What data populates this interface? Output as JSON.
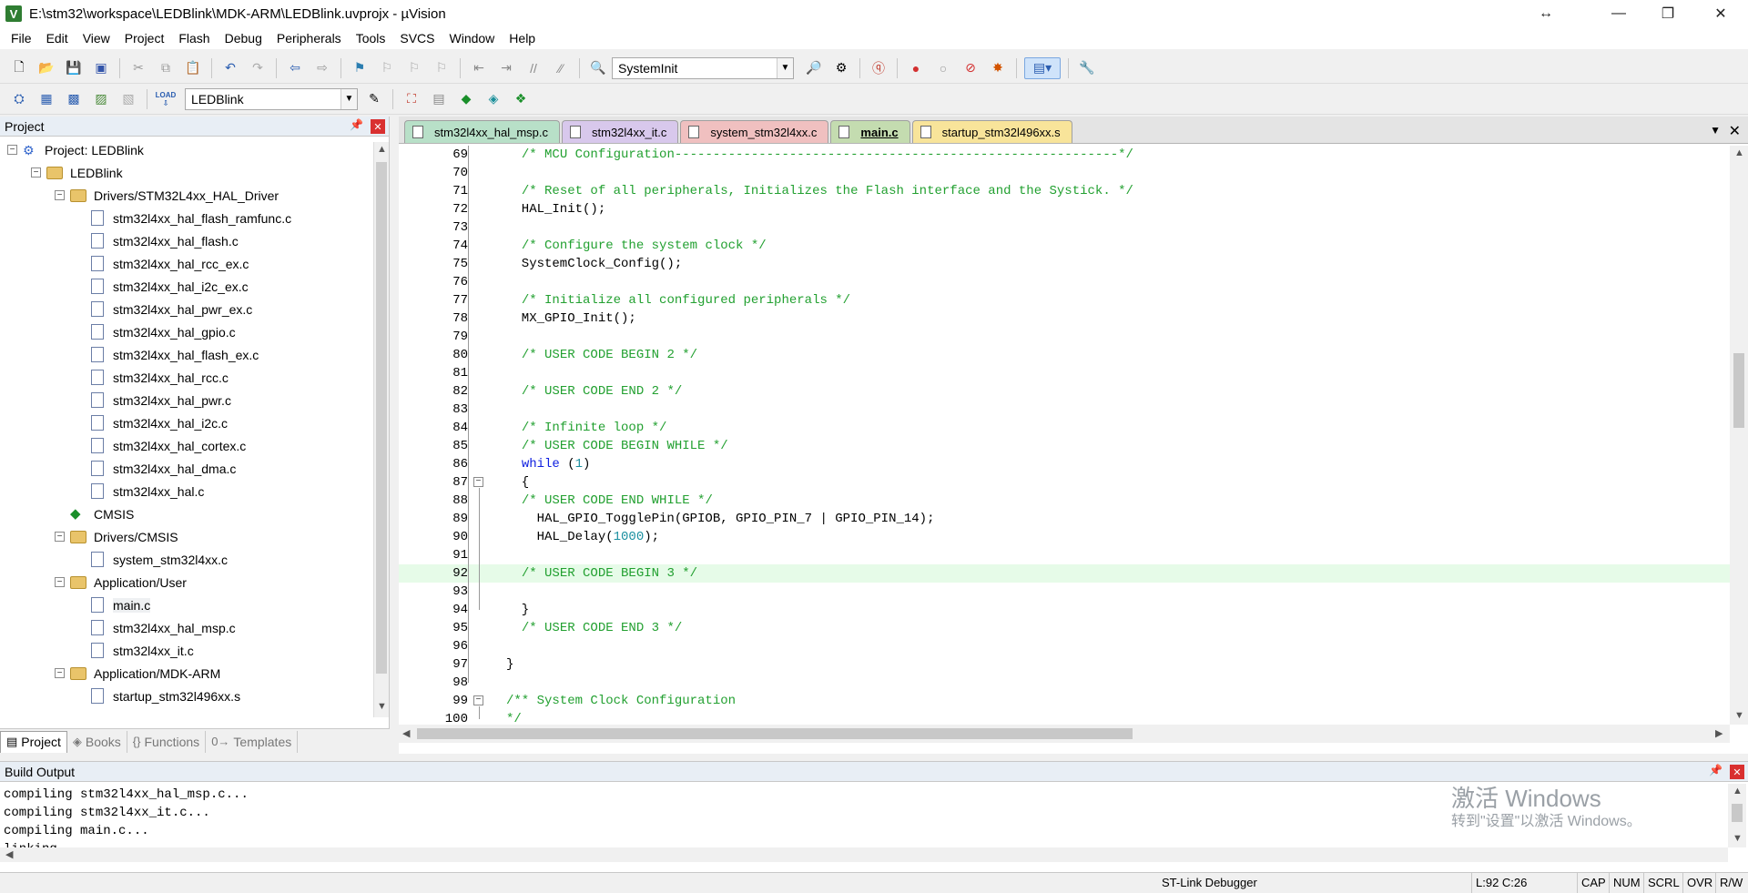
{
  "window": {
    "title": "E:\\stm32\\workspace\\LEDBlink\\MDK-ARM\\LEDBlink.uvprojx - µVision",
    "icon_letter": "V"
  },
  "menu": [
    "File",
    "Edit",
    "View",
    "Project",
    "Flash",
    "Debug",
    "Peripherals",
    "Tools",
    "SVCS",
    "Window",
    "Help"
  ],
  "toolbar": {
    "function_combo": "SystemInit",
    "target_combo": "LEDBlink",
    "load_label": "LOAD"
  },
  "project_panel": {
    "title": "Project",
    "tree": [
      {
        "label": "Project: LEDBlink",
        "level": 0,
        "kind": "project",
        "toggle": "−"
      },
      {
        "label": "LEDBlink",
        "level": 1,
        "kind": "folder",
        "toggle": "−"
      },
      {
        "label": "Drivers/STM32L4xx_HAL_Driver",
        "level": 2,
        "kind": "folder",
        "toggle": "−"
      },
      {
        "label": "stm32l4xx_hal_flash_ramfunc.c",
        "level": 3,
        "kind": "file"
      },
      {
        "label": "stm32l4xx_hal_flash.c",
        "level": 3,
        "kind": "file"
      },
      {
        "label": "stm32l4xx_hal_rcc_ex.c",
        "level": 3,
        "kind": "file"
      },
      {
        "label": "stm32l4xx_hal_i2c_ex.c",
        "level": 3,
        "kind": "file"
      },
      {
        "label": "stm32l4xx_hal_pwr_ex.c",
        "level": 3,
        "kind": "file"
      },
      {
        "label": "stm32l4xx_hal_gpio.c",
        "level": 3,
        "kind": "file"
      },
      {
        "label": "stm32l4xx_hal_flash_ex.c",
        "level": 3,
        "kind": "file"
      },
      {
        "label": "stm32l4xx_hal_rcc.c",
        "level": 3,
        "kind": "file"
      },
      {
        "label": "stm32l4xx_hal_pwr.c",
        "level": 3,
        "kind": "file"
      },
      {
        "label": "stm32l4xx_hal_i2c.c",
        "level": 3,
        "kind": "file"
      },
      {
        "label": "stm32l4xx_hal_cortex.c",
        "level": 3,
        "kind": "file"
      },
      {
        "label": "stm32l4xx_hal_dma.c",
        "level": 3,
        "kind": "file"
      },
      {
        "label": "stm32l4xx_hal.c",
        "level": 3,
        "kind": "file"
      },
      {
        "label": "CMSIS",
        "level": 2,
        "kind": "cmsis"
      },
      {
        "label": "Drivers/CMSIS",
        "level": 2,
        "kind": "folder",
        "toggle": "−"
      },
      {
        "label": "system_stm32l4xx.c",
        "level": 3,
        "kind": "file"
      },
      {
        "label": "Application/User",
        "level": 2,
        "kind": "folder",
        "toggle": "−"
      },
      {
        "label": "main.c",
        "level": 3,
        "kind": "file",
        "selected": true
      },
      {
        "label": "stm32l4xx_hal_msp.c",
        "level": 3,
        "kind": "file"
      },
      {
        "label": "stm32l4xx_it.c",
        "level": 3,
        "kind": "file"
      },
      {
        "label": "Application/MDK-ARM",
        "level": 2,
        "kind": "folder",
        "toggle": "−"
      },
      {
        "label": "startup_stm32l496xx.s",
        "level": 3,
        "kind": "file"
      }
    ],
    "tabs": [
      {
        "label": "Project",
        "icon": "▤",
        "active": true
      },
      {
        "label": "Books",
        "icon": "◈"
      },
      {
        "label": "Functions",
        "icon": "{}"
      },
      {
        "label": "Templates",
        "icon": "0→"
      }
    ]
  },
  "editor": {
    "tabs": [
      {
        "label": "stm32l4xx_hal_msp.c",
        "color": "#b8e0c8"
      },
      {
        "label": "stm32l4xx_it.c",
        "color": "#d8c8ec"
      },
      {
        "label": "system_stm32l4xx.c",
        "color": "#f0c0c0"
      },
      {
        "label": "main.c",
        "color": "#c4dcb0",
        "active": true
      },
      {
        "label": "startup_stm32l496xx.s",
        "color": "#f8e49a"
      }
    ],
    "highlight_line": "92",
    "lines": [
      {
        "n": "69",
        "segs": [
          {
            "t": "  "
          },
          {
            "t": "/* MCU Configuration----------------------------------------------------------*/",
            "c": "comment"
          }
        ]
      },
      {
        "n": "70",
        "segs": [
          {
            "t": ""
          }
        ]
      },
      {
        "n": "71",
        "segs": [
          {
            "t": "  "
          },
          {
            "t": "/* Reset of all peripherals, Initializes the Flash interface and the Systick. */",
            "c": "comment"
          }
        ]
      },
      {
        "n": "72",
        "segs": [
          {
            "t": "  HAL_Init();"
          }
        ]
      },
      {
        "n": "73",
        "segs": [
          {
            "t": ""
          }
        ]
      },
      {
        "n": "74",
        "segs": [
          {
            "t": "  "
          },
          {
            "t": "/* Configure the system clock */",
            "c": "comment"
          }
        ]
      },
      {
        "n": "75",
        "segs": [
          {
            "t": "  SystemClock_Config();"
          }
        ]
      },
      {
        "n": "76",
        "segs": [
          {
            "t": ""
          }
        ]
      },
      {
        "n": "77",
        "segs": [
          {
            "t": "  "
          },
          {
            "t": "/* Initialize all configured peripherals */",
            "c": "comment"
          }
        ]
      },
      {
        "n": "78",
        "segs": [
          {
            "t": "  MX_GPIO_Init();"
          }
        ]
      },
      {
        "n": "79",
        "segs": [
          {
            "t": ""
          }
        ]
      },
      {
        "n": "80",
        "segs": [
          {
            "t": "  "
          },
          {
            "t": "/* USER CODE BEGIN 2 */",
            "c": "comment"
          }
        ]
      },
      {
        "n": "81",
        "segs": [
          {
            "t": ""
          }
        ]
      },
      {
        "n": "82",
        "segs": [
          {
            "t": "  "
          },
          {
            "t": "/* USER CODE END 2 */",
            "c": "comment"
          }
        ]
      },
      {
        "n": "83",
        "segs": [
          {
            "t": ""
          }
        ]
      },
      {
        "n": "84",
        "segs": [
          {
            "t": "  "
          },
          {
            "t": "/* Infinite loop */",
            "c": "comment"
          }
        ]
      },
      {
        "n": "85",
        "segs": [
          {
            "t": "  "
          },
          {
            "t": "/* USER CODE BEGIN WHILE */",
            "c": "comment"
          }
        ]
      },
      {
        "n": "86",
        "segs": [
          {
            "t": "  "
          },
          {
            "t": "while",
            "c": "kw"
          },
          {
            "t": " ("
          },
          {
            "t": "1",
            "c": "num"
          },
          {
            "t": ")"
          }
        ]
      },
      {
        "n": "87",
        "segs": [
          {
            "t": "  {"
          }
        ],
        "fold": "−"
      },
      {
        "n": "88",
        "segs": [
          {
            "t": "  "
          },
          {
            "t": "/* USER CODE END WHILE */",
            "c": "comment"
          }
        ]
      },
      {
        "n": "89",
        "segs": [
          {
            "t": "    HAL_GPIO_TogglePin(GPIOB, GPIO_PIN_7 | GPIO_PIN_14);"
          }
        ]
      },
      {
        "n": "90",
        "segs": [
          {
            "t": "    HAL_Delay("
          },
          {
            "t": "1000",
            "c": "num"
          },
          {
            "t": ");"
          }
        ]
      },
      {
        "n": "91",
        "segs": [
          {
            "t": ""
          }
        ]
      },
      {
        "n": "92",
        "segs": [
          {
            "t": "  "
          },
          {
            "t": "/* USER CODE BEGIN 3 */",
            "c": "comment"
          }
        ]
      },
      {
        "n": "93",
        "segs": [
          {
            "t": ""
          }
        ]
      },
      {
        "n": "94",
        "segs": [
          {
            "t": "  }"
          }
        ]
      },
      {
        "n": "95",
        "segs": [
          {
            "t": "  "
          },
          {
            "t": "/* USER CODE END 3 */",
            "c": "comment"
          }
        ]
      },
      {
        "n": "96",
        "segs": [
          {
            "t": ""
          }
        ]
      },
      {
        "n": "97",
        "segs": [
          {
            "t": "}"
          }
        ]
      },
      {
        "n": "98",
        "segs": [
          {
            "t": ""
          }
        ]
      },
      {
        "n": "99",
        "segs": [
          {
            "t": "/** System Clock Configuration",
            "c": "comment"
          }
        ],
        "fold": "−"
      },
      {
        "n": "100",
        "segs": [
          {
            "t": "*/",
            "c": "comment"
          }
        ]
      }
    ]
  },
  "build_output": {
    "title": "Build Output",
    "text": "compiling stm32l4xx_hal_msp.c...\ncompiling stm32l4xx_it.c...\ncompiling main.c...\nlinking...",
    "watermark_title": "激活 Windows",
    "watermark_sub": "转到\"设置\"以激活 Windows。"
  },
  "status": {
    "debugger": "ST-Link Debugger",
    "position": "L:92 C:26",
    "caps": "CAP",
    "num": "NUM",
    "scrl": "SCRL",
    "ovr": "OVR",
    "rw": "R/W"
  }
}
